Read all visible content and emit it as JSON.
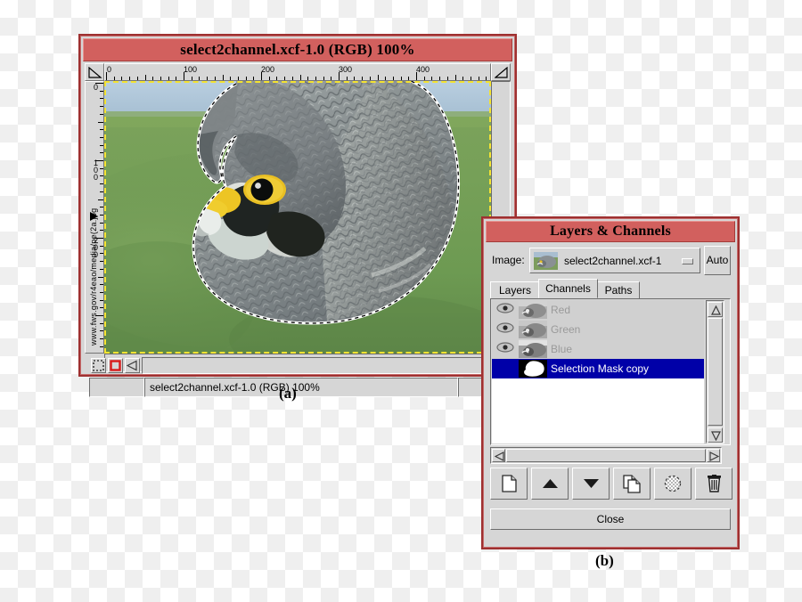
{
  "image_window": {
    "title": "select2channel.xcf-1.0 (RGB) 100%",
    "statusbar": "select2channel.xcf-1.0 (RGB) 100%",
    "ruler_h_labels": [
      "0",
      "100",
      "200",
      "300",
      "400"
    ],
    "ruler_v_labels": [
      "0",
      "100",
      "200"
    ],
    "source_url": "www.fws.gov/r4eao/media/pe(2a.jpg",
    "quickmask": {
      "off_icon": "dotted-square-icon",
      "on_icon": "red-square-icon",
      "nav_icon": "navigation-arrow-icon"
    },
    "photo": {
      "subject": "peregrine-falcon-head",
      "background_top": "#a9c4d8",
      "background_grass": "#6e9a55",
      "selection_outline": "marching-ants"
    }
  },
  "layers_channels": {
    "title": "Layers & Channels",
    "image_label": "Image:",
    "image_value": "select2channel.xcf-1",
    "auto_label": "Auto",
    "tabs": [
      {
        "label": "Layers",
        "active": false
      },
      {
        "label": "Channels",
        "active": true
      },
      {
        "label": "Paths",
        "active": false
      }
    ],
    "channels": [
      {
        "name": "Red",
        "visible": true,
        "selected": false,
        "thumb": "grey"
      },
      {
        "name": "Green",
        "visible": true,
        "selected": false,
        "thumb": "grey"
      },
      {
        "name": "Blue",
        "visible": true,
        "selected": false,
        "thumb": "grey"
      },
      {
        "name": "Selection Mask copy",
        "visible": false,
        "selected": true,
        "thumb": "mask"
      }
    ],
    "toolbar": [
      {
        "icon": "new-channel-icon",
        "label": "New Channel"
      },
      {
        "icon": "raise-channel-icon",
        "label": "Raise Channel"
      },
      {
        "icon": "lower-channel-icon",
        "label": "Lower Channel"
      },
      {
        "icon": "duplicate-channel-icon",
        "label": "Duplicate Channel"
      },
      {
        "icon": "channel-to-selection-icon",
        "label": "Channel to Selection"
      },
      {
        "icon": "delete-channel-icon",
        "label": "Delete Channel"
      }
    ],
    "close_label": "Close"
  },
  "captions": {
    "a": "(a)",
    "b": "(b)"
  },
  "colors": {
    "titlebar_red": "#d2605e",
    "window_border": "#9e3030",
    "widget_face": "#d6d6d6",
    "selection_blue": "#0000a8",
    "checker_light": "#ffffff",
    "checker_dark": "#efefef"
  }
}
